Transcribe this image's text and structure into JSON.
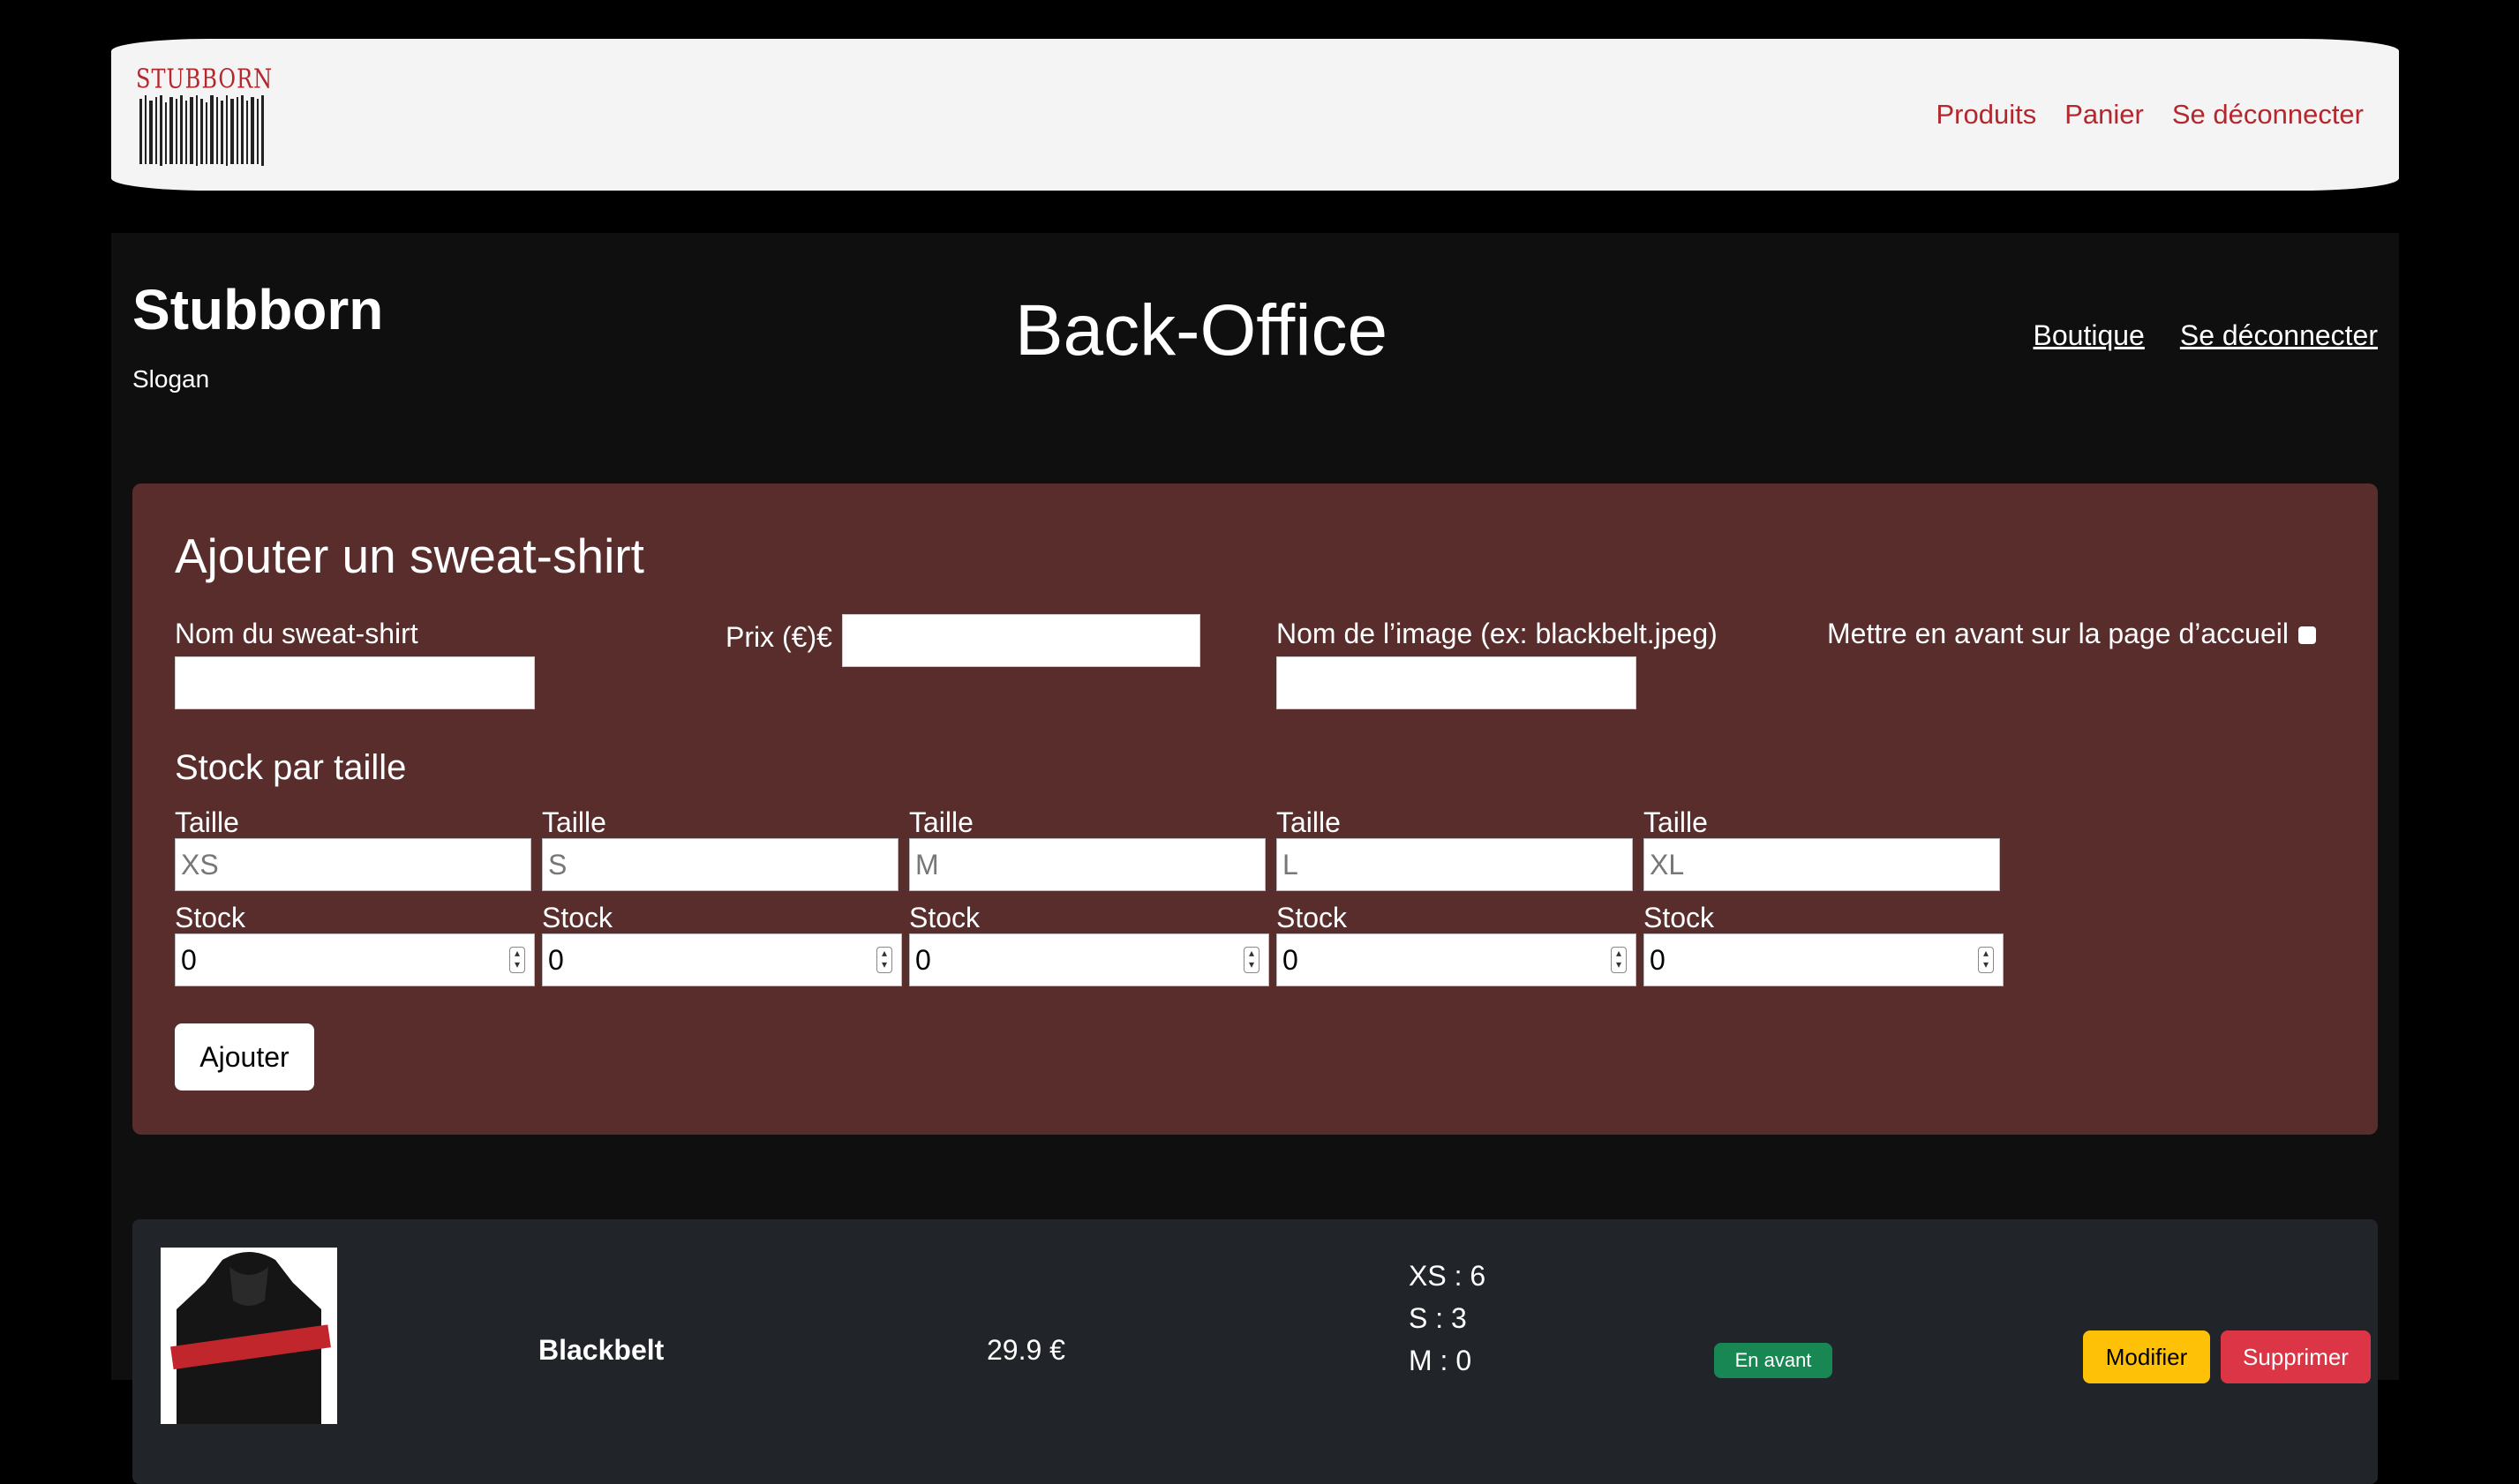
{
  "navbar": {
    "logo_text": "STUBBORN",
    "links": [
      "Produits",
      "Panier",
      "Se déconnecter"
    ]
  },
  "header": {
    "brand": "Stubborn",
    "slogan": "Slogan",
    "page_title": "Back-Office",
    "links": [
      "Boutique",
      "Se déconnecter"
    ]
  },
  "form": {
    "title": "Ajouter un sweat-shirt",
    "name_label": "Nom du sweat-shirt",
    "price_label": "Prix (€)€",
    "image_label": "Nom de l’image (ex: blackbelt.jpeg)",
    "featured_label": "Mettre en avant sur la page d’accueil",
    "stock_section_title": "Stock par taille",
    "sizes": [
      {
        "size_label": "Taille",
        "size_value": "XS",
        "stock_label": "Stock",
        "stock_value": "0"
      },
      {
        "size_label": "Taille",
        "size_value": "S",
        "stock_label": "Stock",
        "stock_value": "0"
      },
      {
        "size_label": "Taille",
        "size_value": "M",
        "stock_label": "Stock",
        "stock_value": "0"
      },
      {
        "size_label": "Taille",
        "size_value": "L",
        "stock_label": "Stock",
        "stock_value": "0"
      },
      {
        "size_label": "Taille",
        "size_value": "XL",
        "stock_label": "Stock",
        "stock_value": "0"
      }
    ],
    "submit_label": "Ajouter"
  },
  "products": [
    {
      "name": "Blackbelt",
      "price": "29.9 €",
      "stock_lines": [
        "XS : 6",
        "S : 3",
        "M : 0"
      ],
      "badge": "En avant",
      "edit_label": "Modifier",
      "delete_label": "Supprimer"
    }
  ],
  "colors": {
    "accent_red": "#b3272d",
    "form_bg": "#5a2d2d",
    "card_bg": "#212529"
  }
}
